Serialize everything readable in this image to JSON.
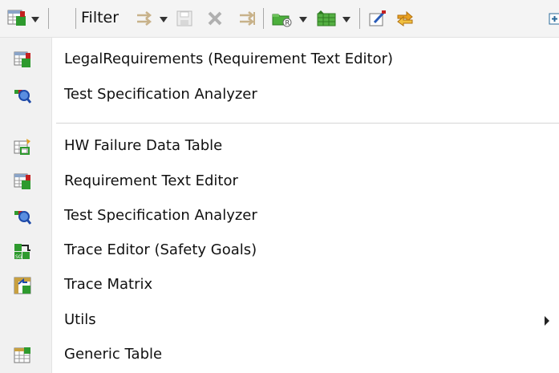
{
  "toolbar": {
    "filter_label": "Filter"
  },
  "menu": {
    "items": [
      {
        "label": "LegalRequirements (Requirement Text Editor)",
        "icon": "table-editor-icon"
      },
      {
        "label": "Test Specification Analyzer",
        "icon": "magnifier-icon"
      },
      {
        "label": "HW Failure Data Table",
        "icon": "hw-table-icon"
      },
      {
        "label": "Requirement Text Editor",
        "icon": "table-editor-icon"
      },
      {
        "label": "Test Specification Analyzer",
        "icon": "magnifier-icon"
      },
      {
        "label": "Trace Editor (Safety Goals)",
        "icon": "trace-editor-icon"
      },
      {
        "label": "Trace Matrix",
        "icon": "trace-matrix-icon"
      },
      {
        "label": "Utils",
        "icon": "none",
        "has_submenu": true
      },
      {
        "label": "Generic Table",
        "icon": "generic-table-icon"
      }
    ]
  },
  "colors": {
    "toolbar_bg": "#f4f4f4",
    "menu_gutter": "#f1f1f1",
    "icon_green": "#3a9a2a",
    "icon_red": "#c62020",
    "icon_blue": "#2a62c8"
  }
}
